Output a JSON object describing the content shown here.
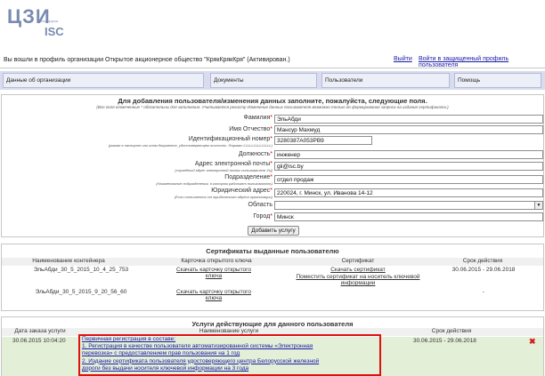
{
  "logo": {
    "main": "ЦЗИ",
    "sub": "ISC",
    "tiny": "Белорусск"
  },
  "status": {
    "text": "Вы вошли в профиль организации Открытое акционерное общество \"КрякКрякКря\"  (Активирован.)",
    "exit_link": "Выйти",
    "protected_link": "Войти в защищенный профиль пользователя"
  },
  "nav": {
    "items": [
      {
        "label": "Данные об организации"
      },
      {
        "label": "Документы"
      },
      {
        "label": "Пользователи"
      },
      {
        "label": "Помощь"
      }
    ]
  },
  "form": {
    "title": "Для добавления пользователя/изменения данных заполните, пожалуйста, следующие поля.",
    "note": "(Все поля отмеченные * обязательны для заполнения. Учитывается регистр Изменение данных пользователя возможно только до формирования запроса на издание сертификата.)",
    "fields": [
      {
        "label": "Фамилия",
        "required": "*",
        "value": "ЭльАбди",
        "sub": ""
      },
      {
        "label": "Имя Отчество",
        "required": "*",
        "value": "Мансур Махмуд",
        "sub": ""
      },
      {
        "label": "Идентификационный номер",
        "required": "*",
        "value": "3280387A053PB9",
        "sub": "(указан в паспорте или ином документе, удостоверяющем личность. Формат LLLLLLLLLLLLLL)"
      },
      {
        "label": "Должность",
        "required": "*",
        "value": "инженер",
        "sub": ""
      },
      {
        "label": "Адрес электронной почты",
        "required": "*",
        "value": "gii@isc.by",
        "sub": "(служебный адрес электронной почты пользователя УЦ)"
      },
      {
        "label": "Подразделение",
        "required": "*",
        "value": "отдел продаж",
        "sub": "(Наименование подразделения, в котором работает пользователь)"
      },
      {
        "label": "Юридический адрес",
        "required": "*",
        "value": "220024, г. Минск, ул. Иванова 14-12",
        "sub": "(Если отличается от юридического адреса организации)"
      },
      {
        "label": "Область",
        "required": "",
        "value": "",
        "sub": ""
      },
      {
        "label": "Город",
        "required": "*",
        "value": "Минск",
        "sub": ""
      }
    ],
    "submit": "Добавить услугу"
  },
  "certs": {
    "title": "Сертификаты выданные пользователю",
    "columns": [
      "Наименование контейнера",
      "Карточка открытого ключа",
      "Сертификат",
      "Срок действия"
    ],
    "rows": [
      {
        "container": "ЭльАбди_30_5_2015_10_4_25_753",
        "card": "Скачать карточку открытого ключа",
        "cert_download": "Скачать сертификат",
        "cert_place": "Поместить сертификат на носитель ключевой информации",
        "period": "30.06.2015 - 29.06.2018"
      },
      {
        "container": "ЭльАбди_30_5_2015_9_20_56_60",
        "card": "Скачать карточку открытого ключа",
        "cert_download": "",
        "cert_place": "",
        "period": "-"
      }
    ]
  },
  "services": {
    "title": "Услуги действующие для данного пользователя",
    "columns": [
      "Дата заказа услуги",
      "Наименование услуги",
      "Срок действия"
    ],
    "row": {
      "date": "30.06.2015 10:04:20",
      "lines": [
        "Первичная регистрация в составе:",
        "1. Регистрация в качестве пользователя автоматизированной системы «Электронная",
        "перевозка» с предоставлением прав пользования на 1 год",
        "2. Издание сертификата пользователя удостоверяющего центра Белорусской железной",
        "дороги без выдачи носителя ключевой информации на 3 года"
      ],
      "period": "30.06.2015 - 29.06.2018",
      "delete_icon": "✖"
    }
  },
  "colors": {
    "nav_bg": "#d7dcee",
    "service_row_bg": "#e3efd6",
    "highlight": "#e01010",
    "link": "#1a1aa6"
  }
}
